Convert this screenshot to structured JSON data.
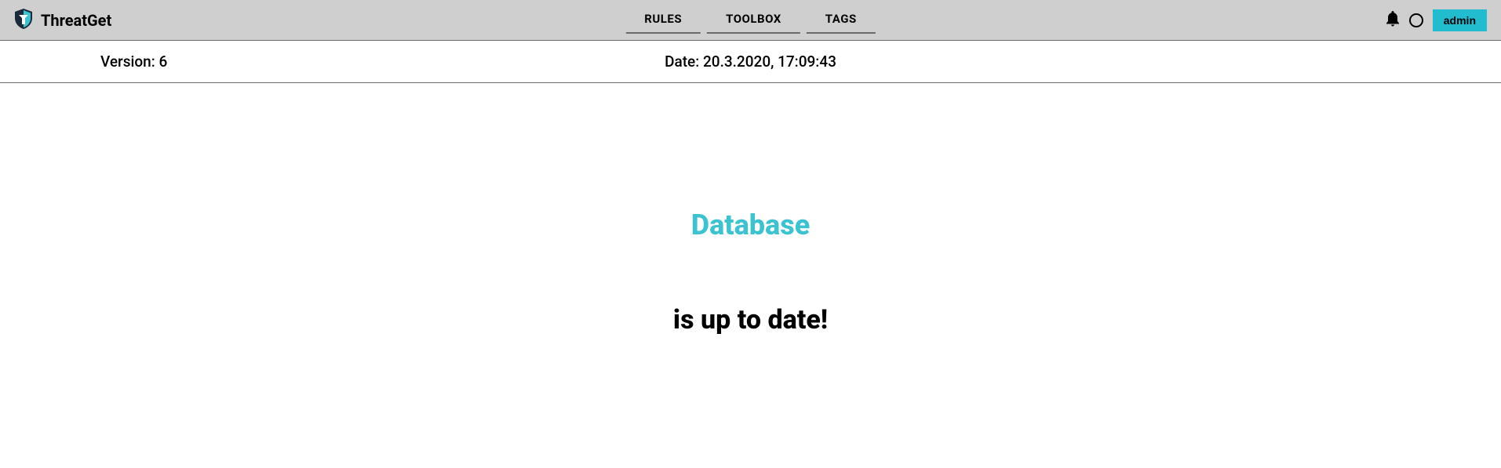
{
  "header": {
    "app_title": "ThreatGet",
    "nav": {
      "rules": "RULES",
      "toolbox": "TOOLBOX",
      "tags": "TAGS"
    },
    "user_label": "admin"
  },
  "info_bar": {
    "version_text": "Version: 6",
    "date_text": "Date: 20.3.2020, 17:09:43"
  },
  "main": {
    "status_title": "Database",
    "status_message": "is up to date!"
  },
  "colors": {
    "accent": "#3bc3d1",
    "header_bg": "#cfcfcf",
    "user_btn_bg": "#22bccf"
  }
}
